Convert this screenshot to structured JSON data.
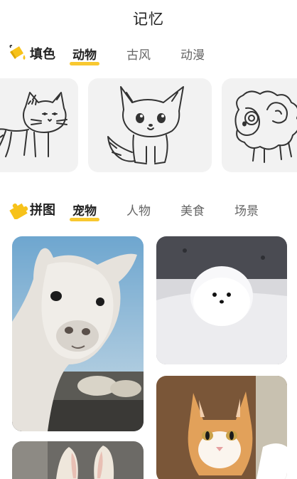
{
  "header": {
    "title": "记忆"
  },
  "coloring": {
    "section_title": "填色",
    "icon": "paint-bucket-icon",
    "tabs": [
      {
        "label": "动物",
        "active": true
      },
      {
        "label": "古风",
        "active": false
      },
      {
        "label": "动漫",
        "active": false
      }
    ],
    "cards": [
      {
        "subject": "cat-line-drawing"
      },
      {
        "subject": "fox-line-drawing"
      },
      {
        "subject": "sheep-line-drawing"
      }
    ]
  },
  "puzzle": {
    "section_title": "拼图",
    "icon": "puzzle-piece-icon",
    "tabs": [
      {
        "label": "宠物",
        "active": true
      },
      {
        "label": "人物",
        "active": false
      },
      {
        "label": "美食",
        "active": false
      },
      {
        "label": "场景",
        "active": false
      }
    ],
    "photos": [
      {
        "subject": "alpaca-photo"
      },
      {
        "subject": "white-pomeranian-photo"
      },
      {
        "subject": "orange-cat-photo"
      },
      {
        "subject": "rabbit-photo"
      }
    ]
  },
  "colors": {
    "accent": "#f7c21a",
    "card_bg": "#f2f2f2",
    "text": "#222222",
    "tab_inactive": "#666666"
  }
}
